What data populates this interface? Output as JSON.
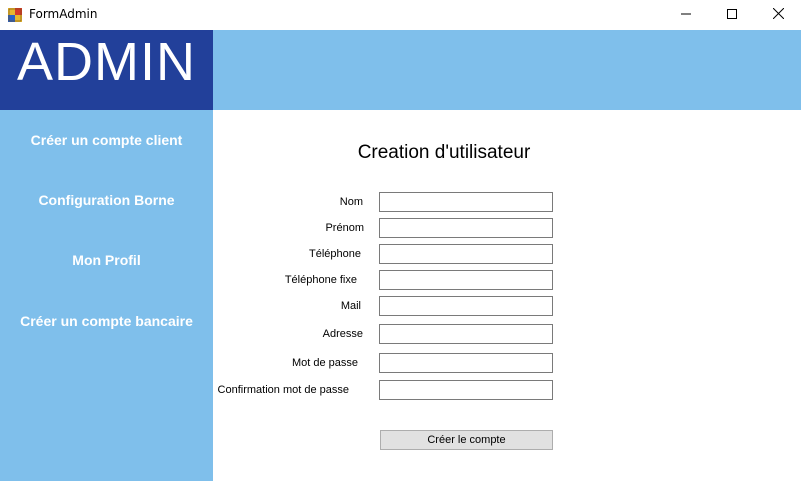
{
  "window": {
    "title": "FormAdmin"
  },
  "sidebar": {
    "logo_text": "ADMIN",
    "items": [
      {
        "label": "Créer un compte client"
      },
      {
        "label": "Configuration Borne"
      },
      {
        "label": "Mon Profil"
      },
      {
        "label": "Créer un compte bancaire"
      }
    ]
  },
  "form": {
    "title": "Creation d'utilisateur",
    "fields": [
      {
        "label": "Nom",
        "value": ""
      },
      {
        "label": "Prénom",
        "value": ""
      },
      {
        "label": "Téléphone",
        "value": ""
      },
      {
        "label": "Téléphone fixe",
        "value": ""
      },
      {
        "label": "Mail",
        "value": ""
      },
      {
        "label": "Adresse",
        "value": ""
      },
      {
        "label": "Mot de passe",
        "value": ""
      },
      {
        "label": "Confirmation mot de passe",
        "value": ""
      }
    ],
    "submit_label": "Créer le compte"
  },
  "colors": {
    "sidebar_bg": "#7fbfeb",
    "logo_bg": "#22409a",
    "header_bg": "#7fbfeb",
    "button_bg": "#e1e1e1"
  },
  "icons": {
    "app": "form-app-icon",
    "minimize": "minimize-icon",
    "maximize": "maximize-icon",
    "close": "close-icon"
  }
}
